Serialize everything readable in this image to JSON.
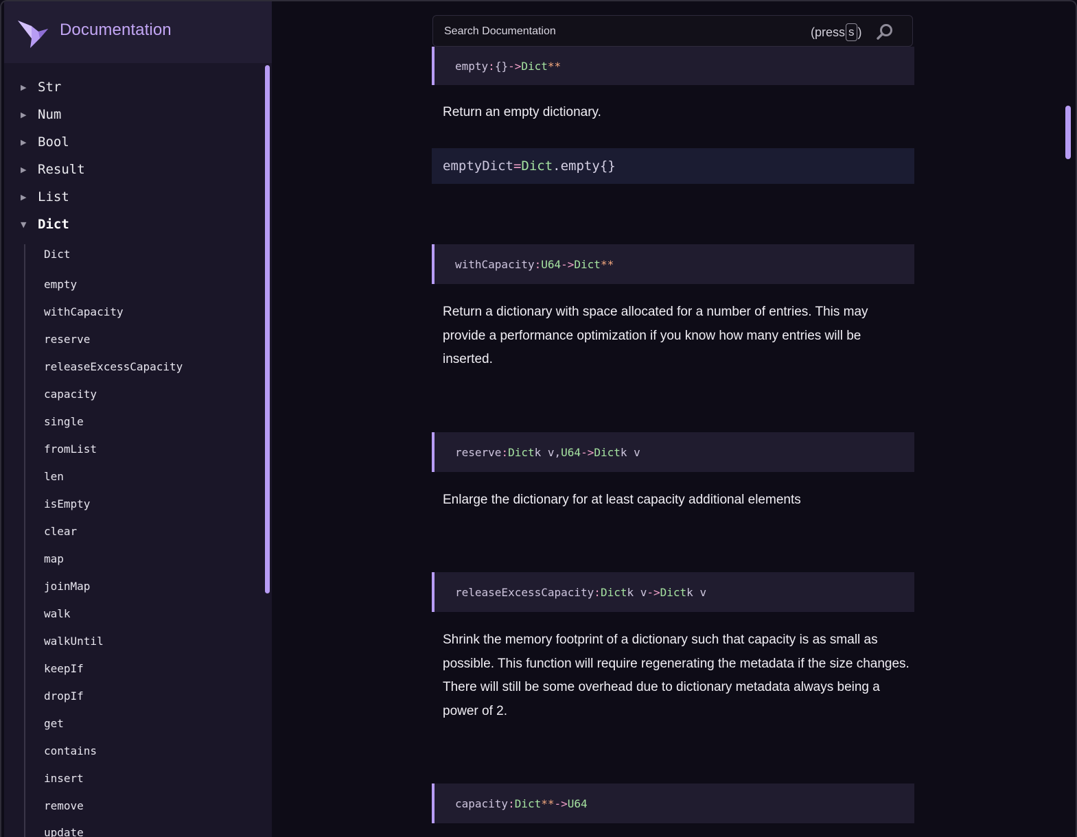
{
  "sidebar": {
    "title": "Documentation",
    "modules": [
      {
        "name": "Str",
        "expanded": false
      },
      {
        "name": "Num",
        "expanded": false
      },
      {
        "name": "Bool",
        "expanded": false
      },
      {
        "name": "Result",
        "expanded": false
      },
      {
        "name": "List",
        "expanded": false
      },
      {
        "name": "Dict",
        "expanded": true
      }
    ],
    "collapsed_marker": "▶",
    "expanded_marker": "▼",
    "dict_items": [
      "Dict",
      "empty",
      "withCapacity",
      "reserve",
      "releaseExcessCapacity",
      "capacity",
      "single",
      "fromList",
      "len",
      "isEmpty",
      "clear",
      "map",
      "joinMap",
      "walk",
      "walkUntil",
      "keepIf",
      "dropIf",
      "get",
      "contains",
      "insert",
      "remove",
      "update"
    ]
  },
  "search": {
    "placeholder": "Search Documentation",
    "hint_prefix": "(press",
    "hint_key": "s",
    "hint_suffix": ")"
  },
  "entries": {
    "empty": {
      "name": "empty",
      "sig_arg": "{}",
      "sig_ret": "Dict",
      "doc": "Return an empty dictionary.",
      "example": {
        "var": "emptyDict",
        "eq": "=",
        "module": "Dict",
        "fn": ".empty",
        "arg": "{}"
      }
    },
    "withCapacity": {
      "name": "withCapacity",
      "sig_arg": "U64",
      "sig_ret": "Dict",
      "doc": "Return a dictionary with space allocated for a number of entries. This may provide a performance optimization if you know how many entries will be inserted."
    },
    "reserve": {
      "name": "reserve",
      "sig_arg1": "Dict",
      "sig_arg1_vars": "k v",
      "sig_arg2": "U64",
      "sig_ret": "Dict",
      "sig_ret_vars": "k v",
      "doc": "Enlarge the dictionary for at least capacity additional elements"
    },
    "releaseExcessCapacity": {
      "name": "releaseExcessCapacity",
      "sig_arg": "Dict",
      "sig_arg_vars": "k v",
      "sig_ret": "Dict",
      "sig_ret_vars": "k v",
      "doc": "Shrink the memory footprint of a dictionary such that capacity is as small as possible. This function will require regenerating the metadata if the size changes. There will still be some overhead due to dictionary metadata always being a power of 2."
    },
    "capacity": {
      "name": "capacity",
      "sig_arg": "Dict",
      "sig_ret": "U64"
    }
  },
  "syntax": {
    "colon": ":",
    "arrow": "->",
    "comma": ",",
    "star": "*"
  },
  "colors": {
    "accent": "#b79cf4",
    "background": "#0e0c17",
    "sidebar": "#1a1628",
    "signature_bg": "#201c2f",
    "type": "#a6e3a1",
    "operator": "#f0a0c8",
    "type_var_star": "#f5a97f"
  }
}
